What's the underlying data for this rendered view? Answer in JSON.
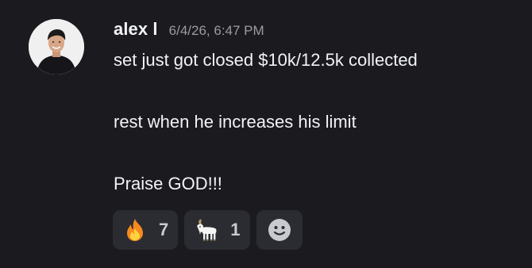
{
  "message": {
    "username": "alex l",
    "timestamp": "6/4/26, 6:47 PM",
    "lines": [
      "set just got closed $10k/12.5k collected",
      "rest when he increases his limit",
      "Praise GOD!!!"
    ]
  },
  "reactions": [
    {
      "icon": "fire-icon",
      "count": "7"
    },
    {
      "icon": "goat-icon",
      "count": "1"
    }
  ],
  "add_reaction_icon": "smiley-icon",
  "colors": {
    "background": "#1b1b1f",
    "reaction_bg": "#2b2c31",
    "text": "#f2f3f5",
    "muted": "#9a9ba3"
  }
}
